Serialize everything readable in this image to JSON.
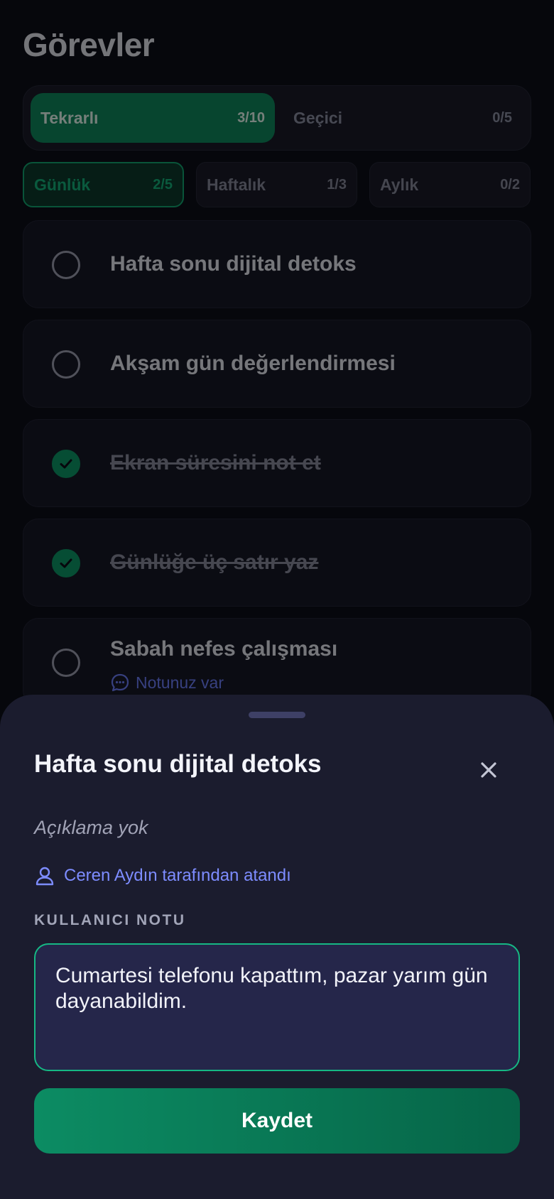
{
  "page": {
    "title": "Görevler"
  },
  "segments": [
    {
      "label": "Tekrarlı",
      "count": "3/10",
      "active": true
    },
    {
      "label": "Geçici",
      "count": "0/5",
      "active": false
    }
  ],
  "frequency": [
    {
      "label": "Günlük",
      "count": "2/5",
      "active": true
    },
    {
      "label": "Haftalık",
      "count": "1/3",
      "active": false
    },
    {
      "label": "Aylık",
      "count": "0/2",
      "active": false
    }
  ],
  "tasks": [
    {
      "label": "Hafta sonu dijital detoks",
      "done": false
    },
    {
      "label": "Akşam gün değerlendirmesi",
      "done": false
    },
    {
      "label": "Ekran süresini not et",
      "done": true
    },
    {
      "label": "Günlüğe üç satır yaz",
      "done": true
    },
    {
      "label": "Sabah nefes çalışması",
      "done": false,
      "note": "Notunuz var"
    }
  ],
  "sheet": {
    "title": "Hafta sonu dijital detoks",
    "description": "Açıklama yok",
    "assigned_by": "Ceren Aydın tarafından atandı",
    "note_label": "KULLANICI NOTU",
    "note_value": "Cumartesi telefonu kapattım, pazar yarım gün dayanabildim.",
    "save_label": "Kaydet"
  },
  "colors": {
    "accent": "#0f8a5f",
    "accent_text": "#15b57c",
    "link": "#7d8cff",
    "background": "#0d0e18",
    "sheet_background": "#1b1c2e"
  },
  "icons": {
    "check": "check-icon",
    "note": "chat-bubble-icon",
    "close": "close-icon",
    "user": "user-icon"
  }
}
